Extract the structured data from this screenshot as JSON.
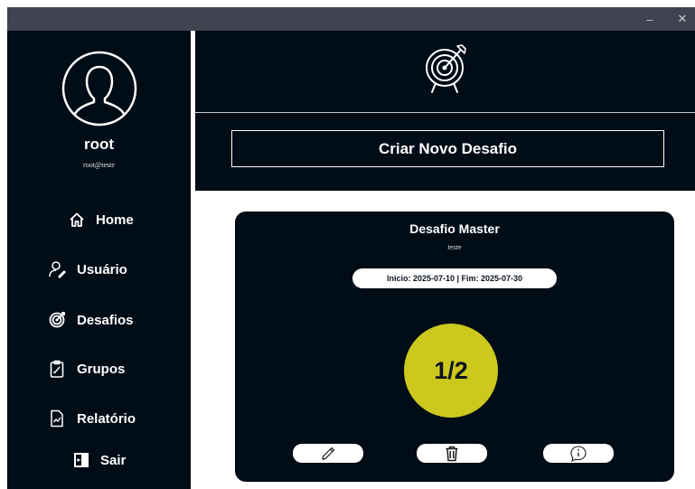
{
  "window": {
    "minimize_glyph": "–",
    "close_glyph": "✕"
  },
  "user": {
    "name": "root",
    "email": "root@teste"
  },
  "nav": {
    "items": [
      {
        "label": "Home",
        "icon": "home-icon"
      },
      {
        "label": "Usuário",
        "icon": "user-edit-icon"
      },
      {
        "label": "Desafios",
        "icon": "target-icon"
      },
      {
        "label": "Grupos",
        "icon": "clipboard-icon"
      },
      {
        "label": "Relatório",
        "icon": "report-chart-icon"
      },
      {
        "label": "Sair",
        "icon": "exit-icon"
      }
    ]
  },
  "header": {
    "icon": "target-arrow-icon",
    "create_button": "Criar Novo Desafio"
  },
  "challenge": {
    "title": "Desafio Master",
    "description": "teste",
    "dates": "Inicio: 2025-07-10 | Fim: 2025-07-30",
    "progress": "1/2",
    "progress_color": "#ccc81d",
    "actions": [
      {
        "icon": "pencil-icon"
      },
      {
        "icon": "trash-icon"
      },
      {
        "icon": "info-icon"
      }
    ]
  },
  "colors": {
    "dark": "#000c16",
    "titlebar": "#3f4450",
    "accent": "#ccc81d"
  }
}
